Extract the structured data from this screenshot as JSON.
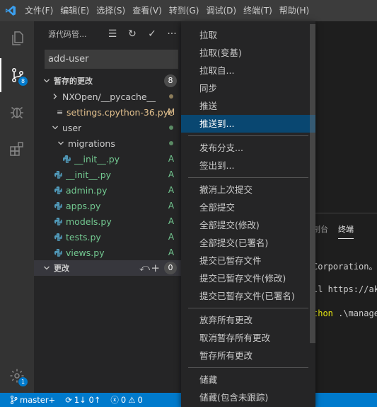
{
  "menubar": [
    "文件(F)",
    "编辑(E)",
    "选择(S)",
    "查看(V)",
    "转到(G)",
    "调试(D)",
    "终端(T)",
    "帮助(H)"
  ],
  "activity": {
    "scm_badge": "8",
    "settings_badge": "1"
  },
  "sidebar": {
    "title": "源代码管...",
    "commit_message": "add-user",
    "staged": {
      "label": "暂存的更改",
      "count": "8"
    },
    "changes": {
      "label": "更改",
      "count": "0"
    },
    "tree": [
      {
        "name": "NXOpen/__pycache__",
        "kind": "folder",
        "status": "dot"
      },
      {
        "name": "settings.cpython-36.pyc",
        "kind": "file",
        "status": "M"
      },
      {
        "name": "user",
        "kind": "folder",
        "status": "dot"
      },
      {
        "name": "migrations",
        "kind": "folder",
        "status": "dot"
      },
      {
        "name": "__init__.py",
        "kind": "py",
        "status": "A"
      },
      {
        "name": "__init__.py",
        "kind": "py",
        "status": "A"
      },
      {
        "name": "admin.py",
        "kind": "py",
        "status": "A"
      },
      {
        "name": "apps.py",
        "kind": "py",
        "status": "A"
      },
      {
        "name": "models.py",
        "kind": "py",
        "status": "A"
      },
      {
        "name": "tests.py",
        "kind": "py",
        "status": "A"
      },
      {
        "name": "views.py",
        "kind": "py",
        "status": "A"
      }
    ]
  },
  "context_menu": {
    "groups": [
      [
        "拉取",
        "拉取(变基)",
        "拉取自...",
        "同步",
        "推送",
        "推送到..."
      ],
      [
        "发布分支...",
        "签出到..."
      ],
      [
        "撤消上次提交",
        "全部提交",
        "全部提交(修改)",
        "全部提交(已署名)",
        "提交已暂存文件",
        "提交已暂存文件(修改)",
        "提交已暂存文件(已署名)"
      ],
      [
        "放弃所有更改",
        "取消暂存所有更改",
        "暂存所有更改"
      ],
      [
        "储藏",
        "储藏(包含未跟踪)"
      ]
    ],
    "highlighted": "推送到..."
  },
  "panel": {
    "tabs": [
      "制台",
      "终端"
    ],
    "lines": [
      "Corporation。",
      "ll https://ak",
      "thon .\\manage"
    ]
  },
  "statusbar": {
    "branch": "master+",
    "sync": "1↓ 0↑",
    "errors": "0",
    "warnings": "0"
  },
  "colors": {
    "accent": "#007acc",
    "added": "#73c991",
    "modified": "#e2c08d",
    "python": "#519aba"
  }
}
